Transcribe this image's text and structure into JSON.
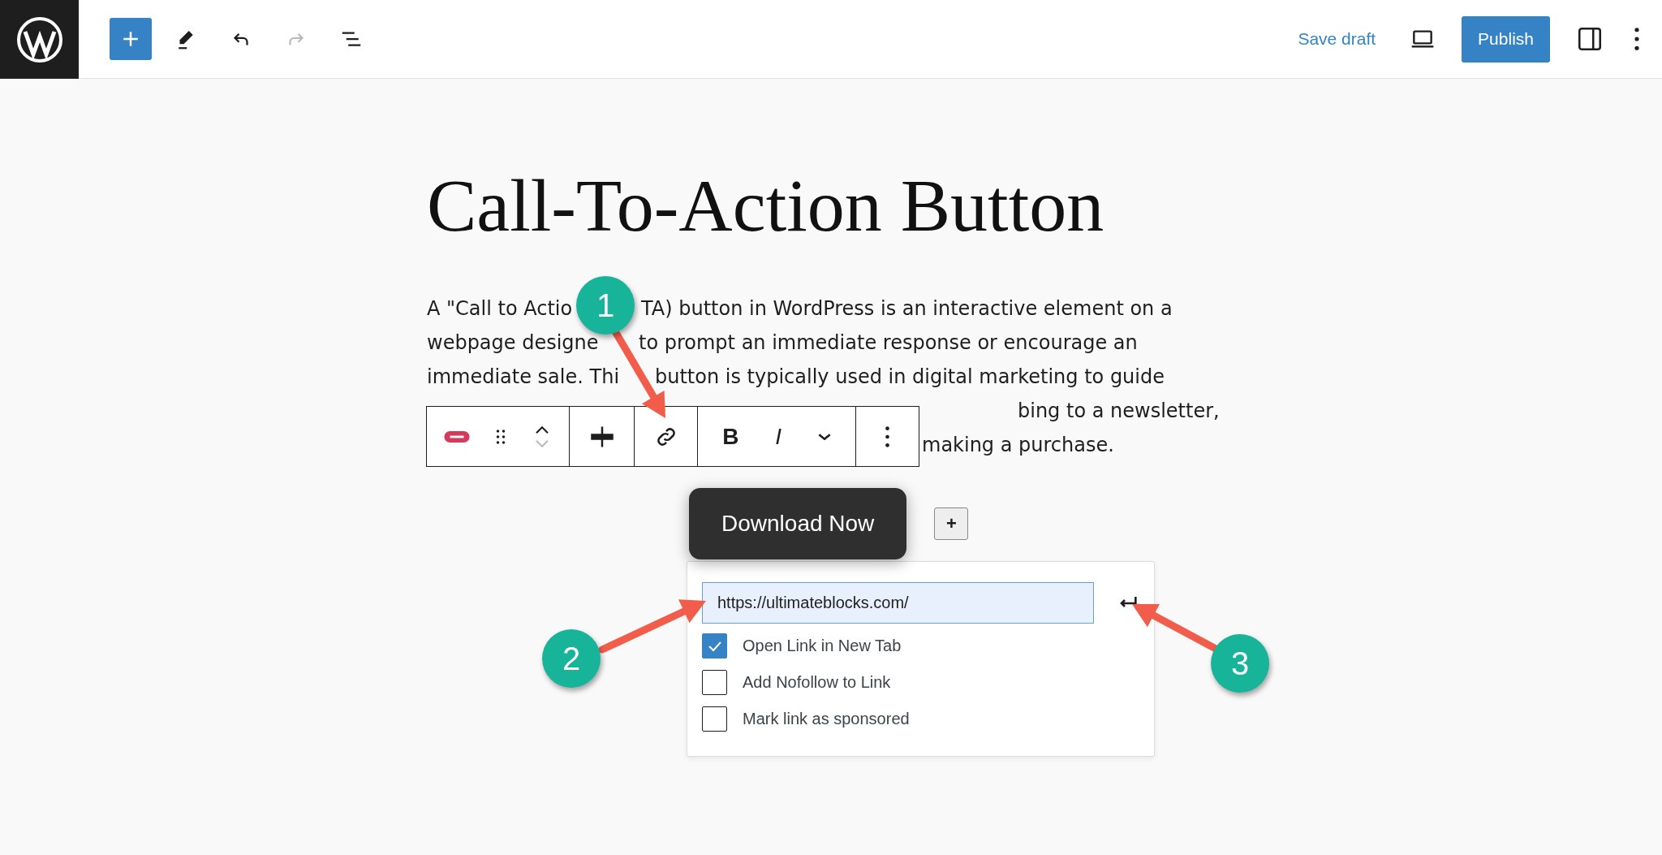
{
  "top_bar": {
    "tools": [
      {
        "kind": "add",
        "disabled": false
      },
      {
        "kind": "edit",
        "disabled": false
      },
      {
        "kind": "undo",
        "disabled": false
      },
      {
        "kind": "redo",
        "disabled": true
      },
      {
        "kind": "list",
        "disabled": false
      }
    ],
    "save_draft": "Save draft",
    "publish": "Publish"
  },
  "title": "Call-To-Action Button",
  "paragraph_lines": [
    {
      "segments": [
        "A \"Call to Actio",
        "TA) button in WordPress is an interactive element on a"
      ]
    },
    {
      "segments": [
        "webpage designe",
        "to prompt an immediate response or encourage an"
      ]
    },
    {
      "segments": [
        "immediate sale. Thi",
        "button is typically used in digital marketing to guide"
      ]
    },
    {
      "segments": [
        "bing to a newsletter,"
      ]
    },
    {
      "segments": [
        "making a purchase."
      ]
    }
  ],
  "block_toolbar": {
    "groups": [
      [
        {
          "kind": "block-type"
        },
        {
          "kind": "drag"
        },
        {
          "kind": "move"
        }
      ],
      [
        {
          "kind": "align"
        }
      ],
      [
        {
          "kind": "link"
        }
      ],
      [
        {
          "kind": "text",
          "text": "B"
        },
        {
          "kind": "text-italic",
          "text": "I"
        },
        {
          "kind": "more-format"
        }
      ],
      [
        {
          "kind": "options"
        }
      ]
    ]
  },
  "cta_button": {
    "label": "Download Now"
  },
  "add_block": {
    "label": "+"
  },
  "link_popover": {
    "url": "https://ultimateblocks.com/",
    "options": [
      {
        "label": "Open Link in New Tab",
        "checked": true
      },
      {
        "label": "Add Nofollow to Link",
        "checked": false
      },
      {
        "label": "Mark link as sponsored",
        "checked": false
      }
    ]
  },
  "annotations": [
    {
      "label": "1"
    },
    {
      "label": "2"
    },
    {
      "label": "3"
    }
  ]
}
